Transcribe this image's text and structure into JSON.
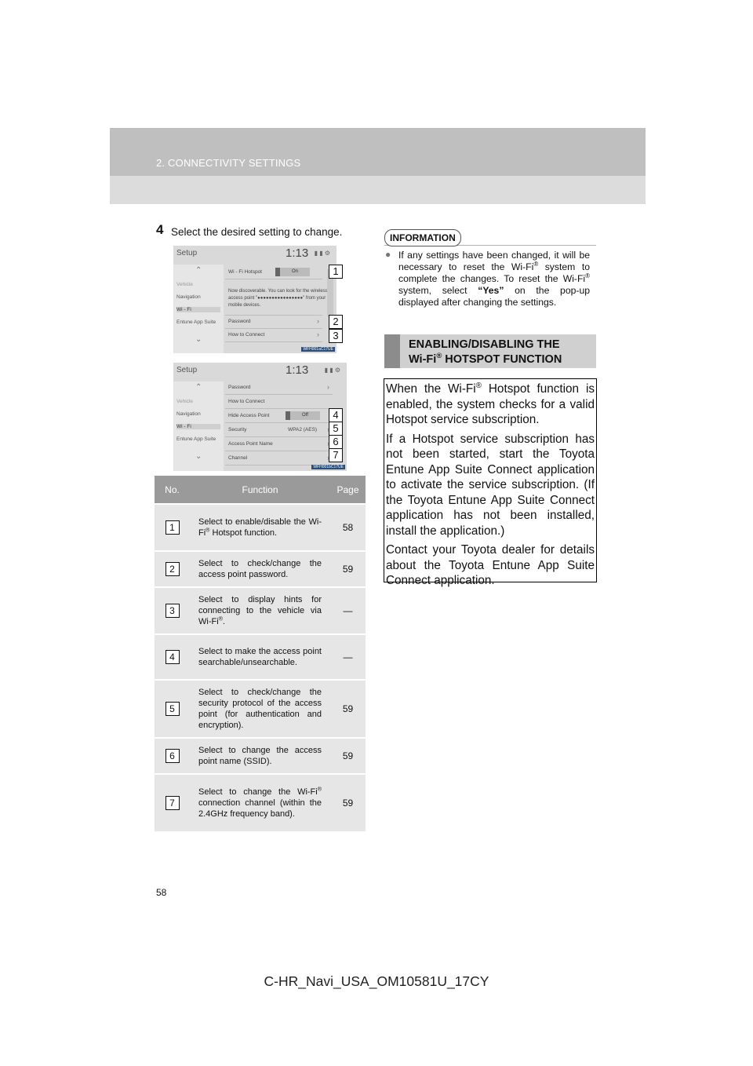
{
  "header": {
    "section_title": "2. CONNECTIVITY SETTINGS"
  },
  "step": {
    "number": "4",
    "text": "Select the desired setting to change."
  },
  "screen1": {
    "title": "Setup",
    "time": "1:13",
    "status": "▮ ▮ ⚙",
    "sidebar": [
      "Vehicle",
      "Navigation",
      "Wi - Fi",
      "Entune App Suite"
    ],
    "rows": [
      {
        "label": "Wi - Fi Hotspot",
        "toggle": "On"
      },
      {
        "label": "Password"
      },
      {
        "label": "How to Connect"
      }
    ],
    "description": "Now discoverable. You can look for the wireless access point \"●●●●●●●●●●●●●●●●\" from your mobile devices.",
    "image_code": "WFH001aC17UE",
    "callouts": [
      "1",
      "2",
      "3"
    ]
  },
  "screen2": {
    "title": "Setup",
    "time": "1:13",
    "status": "▮ ▮ ⚙",
    "sidebar": [
      "Vehicle",
      "Navigation",
      "Wi - Fi",
      "Entune App Suite"
    ],
    "rows": [
      {
        "label": "Password"
      },
      {
        "label": "How to Connect"
      },
      {
        "label": "Hide Access Point",
        "toggle": "Off"
      },
      {
        "label": "Security",
        "value": "WPA2 (AES)"
      },
      {
        "label": "Access Point Name"
      },
      {
        "label": "Channel"
      }
    ],
    "image_code": "WFH001bC17UE",
    "callouts": [
      "4",
      "5",
      "6",
      "7"
    ]
  },
  "table": {
    "headers": {
      "no": "No.",
      "function": "Function",
      "page": "Page"
    },
    "rows": [
      {
        "no": "1",
        "function_pre": "Select to enable/disable the Wi-Fi",
        "reg": "®",
        "function_post": " Hotspot function.",
        "page": "58"
      },
      {
        "no": "2",
        "function_pre": "Select to check/change the access point password.",
        "reg": "",
        "function_post": "",
        "page": "59"
      },
      {
        "no": "3",
        "function_pre": "Select to display hints for connecting to the vehicle via Wi-Fi",
        "reg": "®",
        "function_post": ".",
        "page": "—"
      },
      {
        "no": "4",
        "function_pre": "Select to make the access point searchable/unsearchable.",
        "reg": "",
        "function_post": "",
        "page": "—"
      },
      {
        "no": "5",
        "function_pre": "Select to check/change the security protocol of the access point (for authentication and encryption).",
        "reg": "",
        "function_post": "",
        "page": "59"
      },
      {
        "no": "6",
        "function_pre": "Select to change the access point name (SSID).",
        "reg": "",
        "function_post": "",
        "page": "59"
      },
      {
        "no": "7",
        "function_pre": "Select to change the Wi-Fi",
        "reg": "®",
        "function_post": " connection channel (within the 2.4GHz frequency band).",
        "page": "59"
      }
    ]
  },
  "information": {
    "label": "INFORMATION",
    "bullet": "●",
    "text_a": "If any settings have been changed, it will be necessary to reset the Wi-Fi",
    "reg": "®",
    "text_b": " system to complete the changes. To reset the Wi-Fi",
    "text_c": " system, select ",
    "emphasis": "“Yes”",
    "text_d": " on the pop-up displayed after changing the settings."
  },
  "section_heading": {
    "line1": "ENABLING/DISABLING THE",
    "line2_pre": "Wi-Fi",
    "reg": "®",
    "line2_post": " HOTSPOT FUNCTION"
  },
  "body": {
    "p1_pre": "When the Wi-Fi",
    "reg": "®",
    "p1_post": " Hotspot function is enabled, the system checks for a valid Hotspot service subscription.",
    "p2": "If a Hotspot service subscription has not been started, start the Toyota Entune App Suite Connect application to activate the service subscription. (If the Toyota Entune App Suite Connect application has not been installed, install the application.)",
    "p3": "Contact your Toyota dealer for details about the Toyota Entune App Suite Connect application."
  },
  "page_number": "58",
  "footer_code": "C-HR_Navi_USA_OM10581U_17CY",
  "colors": {
    "header_dark": "#bfbfbf",
    "header_light": "#dcdcdc",
    "table_header": "#9a9a9a",
    "table_cell": "#e6e6e6",
    "heading_bar": "#8c8c8c"
  }
}
